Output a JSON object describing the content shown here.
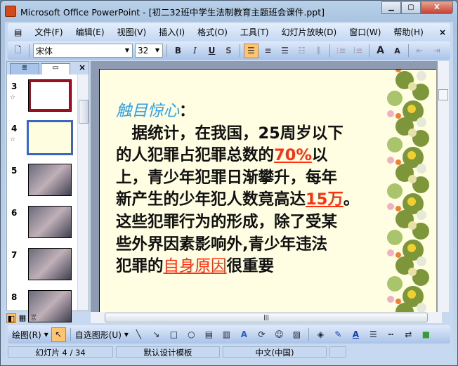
{
  "window": {
    "title": "Microsoft Office PowerPoint - [初二32班中学生法制教育主题班会课件.ppt]",
    "min": "▁",
    "max": "▢",
    "close": "X"
  },
  "menu": [
    "文件(F)",
    "编辑(E)",
    "视图(V)",
    "插入(I)",
    "格式(O)",
    "工具(T)",
    "幻灯片放映(D)",
    "窗口(W)",
    "帮助(H)"
  ],
  "menu_close": "×",
  "toolbar": {
    "font": "宋体",
    "size": "32",
    "bold": "B",
    "italic": "I",
    "underline": "U",
    "shadow": "S",
    "grow": "A",
    "shrink": "A"
  },
  "thumbs": [
    {
      "n": "3",
      "star": "☆"
    },
    {
      "n": "4",
      "star": "☆"
    },
    {
      "n": "5"
    },
    {
      "n": "6"
    },
    {
      "n": "7"
    },
    {
      "n": "8"
    }
  ],
  "slide": {
    "title": "触目惊心",
    "colon": "：",
    "l1": "　据统计，在我国，25周岁以下",
    "l2a": "的人犯罪占犯罪总数的",
    "l2b": "70%",
    "l2c": "以",
    "l3": "上，青少年犯罪日渐攀升，每年",
    "l4a": "新产生的少年犯人数竟高达",
    "l4b": "15万",
    "l4c": "。",
    "l5": "这些犯罪行为的形成，除了受某",
    "l6": "些外界因素影响外,青少年违法",
    "l7a": "犯罪的",
    "l7b": "自身原因",
    "l7c": "很重要"
  },
  "drawbar": {
    "draw": "绘图(R)",
    "autoshapes": "自选图形(U)"
  },
  "status": {
    "slide": "幻灯片 4 / 34",
    "template": "默认设计模板",
    "lang": "中文(中国)"
  },
  "colors": {
    "accent": "#2aa0ef",
    "highlight": "#ff3010",
    "slide_bg": "#fffee2"
  }
}
